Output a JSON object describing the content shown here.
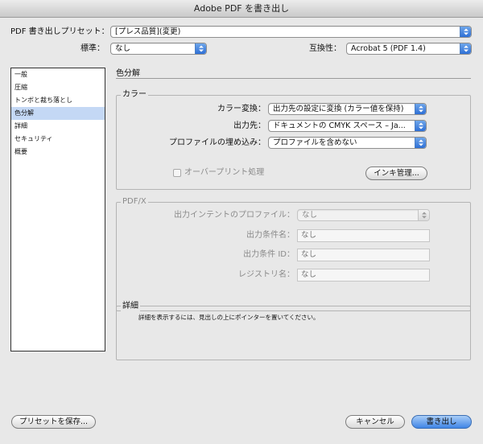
{
  "window": {
    "title": "Adobe PDF を書き出し"
  },
  "preset": {
    "label": "PDF 書き出しプリセット：",
    "value": "[プレス品質](変更)"
  },
  "standard": {
    "label": "標準：",
    "value": "なし"
  },
  "compat": {
    "label": "互換性：",
    "value": "Acrobat 5 (PDF 1.4)"
  },
  "sidebar": {
    "items": [
      {
        "label": "一般"
      },
      {
        "label": "圧縮"
      },
      {
        "label": "トンボと裁ち落とし"
      },
      {
        "label": "色分解"
      },
      {
        "label": "詳細"
      },
      {
        "label": "セキュリティ"
      },
      {
        "label": "概要"
      }
    ]
  },
  "main": {
    "section_title": "色分解"
  },
  "color": {
    "group_title": "カラー",
    "conversion_label": "カラー変換：",
    "conversion_value": "出力先の設定に変換 (カラー値を保持)",
    "destination_label": "出力先：",
    "destination_value": "ドキュメントの CMYK スペース – Ja...",
    "profile_label": "プロファイルの埋め込み：",
    "profile_value": "プロファイルを含めない",
    "overprint_label": "オーバープリント処理",
    "ink_button": "インキ管理..."
  },
  "pdfx": {
    "group_title": "PDF/X",
    "intent_label": "出力インテントのプロファイル：",
    "intent_value": "なし",
    "condition_name_label": "出力条件名：",
    "condition_name_value": "なし",
    "condition_id_label": "出力条件 ID：",
    "condition_id_value": "なし",
    "registry_label": "レジストリ名：",
    "registry_value": "なし"
  },
  "details": {
    "group_title": "詳細",
    "text": "詳細を表示するには、見出しの上にポインターを置いてください。"
  },
  "footer": {
    "save_preset": "プリセットを保存...",
    "cancel": "キャンセル",
    "export": "書き出し"
  },
  "colors": {
    "selection": "#c4d8f5",
    "accent": "#3f85e6"
  },
  "icons": {
    "popup": "up-down-arrows-icon"
  }
}
